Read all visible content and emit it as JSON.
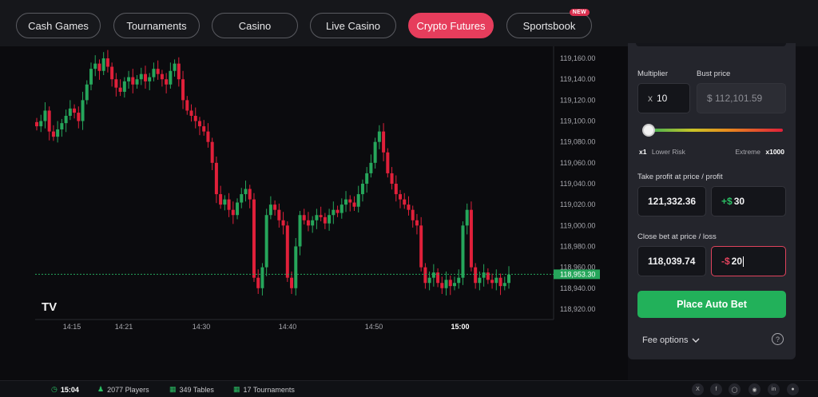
{
  "nav": {
    "items": [
      {
        "label": "Cash Games",
        "active": false
      },
      {
        "label": "Tournaments",
        "active": false
      },
      {
        "label": "Casino",
        "active": false
      },
      {
        "label": "Live Casino",
        "active": false
      },
      {
        "label": "Crypto Futures",
        "active": true
      },
      {
        "label": "Sportsbook",
        "active": false,
        "badge": "NEW"
      }
    ]
  },
  "chart": {
    "logo": "TV",
    "price_labels": [
      "119,160.00",
      "119,140.00",
      "119,120.00",
      "119,100.00",
      "119,080.00",
      "119,060.00",
      "119,040.00",
      "119,020.00",
      "119,000.00",
      "118,980.00",
      "118,960.00",
      "118,940.00",
      "118,920.00"
    ],
    "current_price": "118,953.30",
    "time_labels": [
      "14:15",
      "14:21",
      "14:30",
      "14:40",
      "14:50",
      "15:00"
    ],
    "up_color": "#26a65b",
    "down_color": "#e0203a"
  },
  "chart_data": {
    "type": "candlestick",
    "ylim": [
      118910,
      119170
    ],
    "x_ticks": [
      "14:15",
      "14:21",
      "14:30",
      "14:40",
      "14:50",
      "15:00"
    ],
    "last_price": 118953.3,
    "close_path": [
      119095,
      119100,
      119110,
      119090,
      119085,
      119092,
      119098,
      119105,
      119112,
      119108,
      119100,
      119120,
      119135,
      119150,
      119155,
      119148,
      119160,
      119152,
      119140,
      119132,
      119128,
      119138,
      119142,
      119135,
      119140,
      119145,
      119138,
      119142,
      119150,
      119145,
      119140,
      119135,
      119148,
      119155,
      119140,
      119120,
      119110,
      119105,
      119100,
      119095,
      119090,
      119080,
      119060,
      119030,
      119020,
      119025,
      119015,
      119010,
      119022,
      119030,
      119035,
      119025,
      118950,
      118940,
      118960,
      119010,
      119020,
      119015,
      119005,
      119000,
      118950,
      118940,
      118980,
      119010,
      119005,
      119000,
      119005,
      119010,
      119008,
      119002,
      119010,
      119015,
      119012,
      119020,
      119025,
      119022,
      119018,
      119030,
      119040,
      119050,
      119060,
      119080,
      119090,
      119070,
      119050,
      119040,
      119030,
      119025,
      119020,
      119015,
      119005,
      119000,
      118960,
      118945,
      118950,
      118955,
      118945,
      118940,
      118948,
      118942,
      118945,
      118950,
      119000,
      119015,
      118960,
      118945,
      118950,
      118955,
      118948,
      118945,
      118950,
      118942,
      118945,
      118953
    ]
  },
  "panel": {
    "multiplier_label": "Multiplier",
    "multiplier_prefix": "x",
    "multiplier_value": "10",
    "bust_label": "Bust price",
    "bust_value": "$ 112,101.59",
    "slider_fraction": 0.01,
    "risk_min": "x1",
    "risk_min_label": "Lower Risk",
    "risk_max_label": "Extreme",
    "risk_max": "x1000",
    "tp_label": "Take profit at price / profit",
    "tp_price": "121,332.36",
    "tp_profit_prefix": "+$",
    "tp_profit": "30",
    "sl_label": "Close bet at price / loss",
    "sl_price": "118,039.74",
    "sl_loss_prefix": "-$",
    "sl_loss": "20",
    "place_button": "Place Auto Bet",
    "fee_options": "Fee options",
    "help": "?"
  },
  "footer": {
    "time": "15:04",
    "players": "2077 Players",
    "tables": "349 Tables",
    "tournaments": "17 Tournaments",
    "socials": [
      "x-icon",
      "facebook-icon",
      "instagram-icon",
      "discord-icon",
      "linkedin-icon",
      "reddit-icon"
    ]
  }
}
